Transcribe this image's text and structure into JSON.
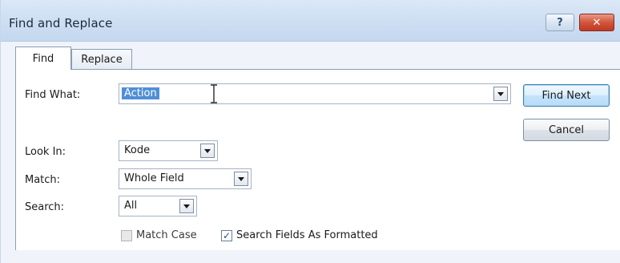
{
  "window": {
    "title": "Find and Replace",
    "help_glyph": "?",
    "close_glyph": "✕"
  },
  "tabs": [
    {
      "label": "Find",
      "active": true
    },
    {
      "label": "Replace",
      "active": false
    }
  ],
  "form": {
    "find_what": {
      "label": "Find What:",
      "value": "Action"
    },
    "look_in": {
      "label": "Look In:",
      "value": "Kode"
    },
    "match": {
      "label": "Match:",
      "value": "Whole Field"
    },
    "search": {
      "label": "Search:",
      "value": "All"
    }
  },
  "buttons": {
    "find_next": "Find Next",
    "cancel": "Cancel"
  },
  "checkboxes": {
    "match_case": {
      "label": "Match Case",
      "checked": false,
      "enabled": false
    },
    "search_formatted": {
      "label": "Search Fields As Formatted",
      "checked": true,
      "enabled": true
    }
  },
  "icons": {
    "help": "help-icon",
    "close": "close-icon",
    "dropdown": "chevron-down-icon",
    "cursor": "text-cursor-icon",
    "checkmark": "checkmark-icon"
  },
  "colors": {
    "title_bar": "#cfe0f3",
    "close_button": "#d2553b",
    "selection": "#4f8fd6",
    "default_button_border": "#3c7fb1"
  }
}
